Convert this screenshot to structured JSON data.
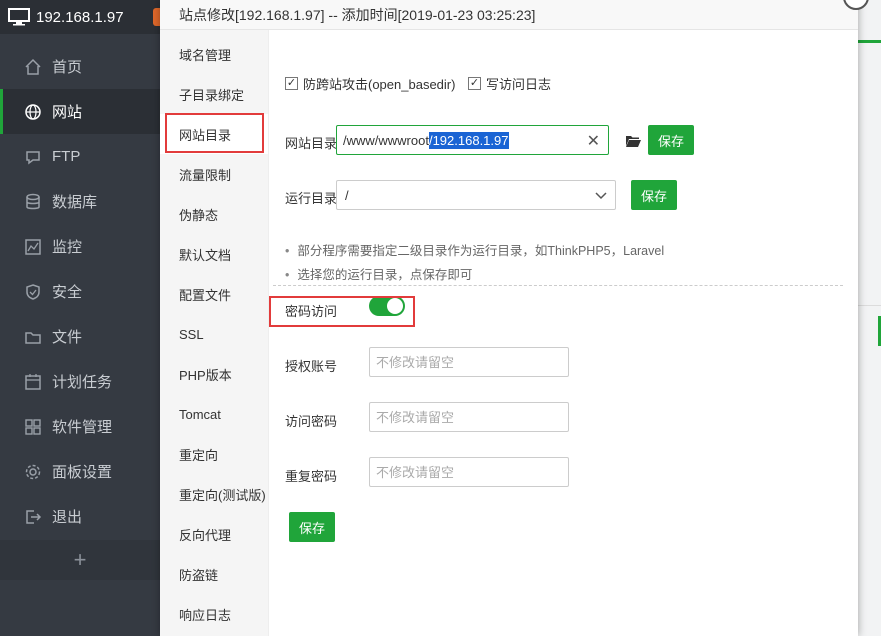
{
  "app": {
    "server_ip": "192.168.1.97",
    "nav": [
      {
        "label": "首页",
        "icon": "home-icon"
      },
      {
        "label": "网站",
        "icon": "globe-icon"
      },
      {
        "label": "FTP",
        "icon": "ftp-icon"
      },
      {
        "label": "数据库",
        "icon": "database-icon"
      },
      {
        "label": "监控",
        "icon": "monitor-icon"
      },
      {
        "label": "安全",
        "icon": "shield-icon"
      },
      {
        "label": "文件",
        "icon": "folder-icon"
      },
      {
        "label": "计划任务",
        "icon": "calendar-icon"
      },
      {
        "label": "软件管理",
        "icon": "grid-icon"
      },
      {
        "label": "面板设置",
        "icon": "gear-icon"
      },
      {
        "label": "退出",
        "icon": "exit-icon"
      }
    ],
    "add_label": "+"
  },
  "modal": {
    "title": "站点修改[192.168.1.97] -- 添加时间[2019-01-23 03:25:23]",
    "menu": [
      "域名管理",
      "子目录绑定",
      "网站目录",
      "流量限制",
      "伪静态",
      "默认文档",
      "配置文件",
      "SSL",
      "PHP版本",
      "Tomcat",
      "重定向",
      "重定向(测试版)",
      "反向代理",
      "防盗链",
      "响应日志"
    ],
    "active_menu": "网站目录",
    "checkbox_basedir": "防跨站攻击(open_basedir)",
    "checkbox_log": "写访问日志",
    "site_dir_label": "网站目录",
    "site_dir_prefix": "/www/wwwroot",
    "site_dir_selected": "/192.168.1.97",
    "save": "保存",
    "run_dir_label": "运行目录",
    "run_dir_value": "/",
    "tips": [
      "部分程序需要指定二级目录作为运行目录，如ThinkPHP5，Laravel",
      "选择您的运行目录，点保存即可"
    ],
    "pwd_access_label": "密码访问",
    "pwd_access_on": true,
    "auth_user_label": "授权账号",
    "access_pwd_label": "访问密码",
    "repeat_pwd_label": "重复密码",
    "placeholder": "不修改请留空"
  },
  "colors": {
    "accent": "#20a53a",
    "highlight": "#e23b3b",
    "sidebar": "#353a42"
  }
}
